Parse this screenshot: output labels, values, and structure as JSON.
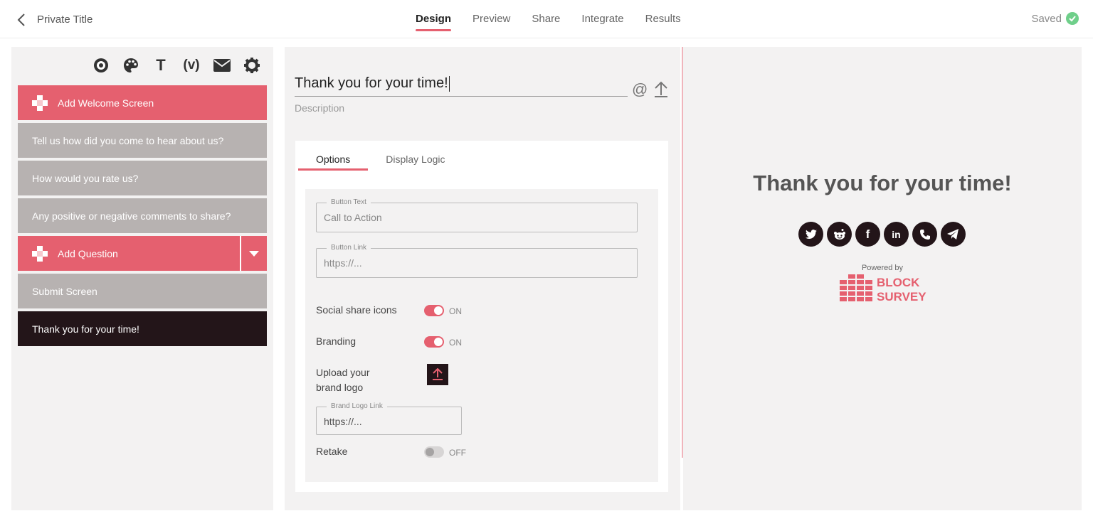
{
  "header": {
    "title": "Private Title",
    "tabs": [
      {
        "label": "Design",
        "active": true
      },
      {
        "label": "Preview",
        "active": false
      },
      {
        "label": "Share",
        "active": false
      },
      {
        "label": "Integrate",
        "active": false
      },
      {
        "label": "Results",
        "active": false
      }
    ],
    "status": "Saved"
  },
  "toolbar": {
    "icons": [
      "target-icon",
      "palette-icon",
      "text-icon",
      "variable-icon",
      "mail-icon",
      "gear-icon"
    ],
    "text_glyph": "T",
    "variable_glyph": "(v)"
  },
  "questions": {
    "add_welcome": "Add Welcome Screen",
    "items": [
      "Tell us how did you come to hear about us?",
      "How would you rate us?",
      "Any positive or negative comments to share?"
    ],
    "add_question": "Add Question",
    "submit": "Submit Screen",
    "thank_you": "Thank you for your time!"
  },
  "editor": {
    "title_value": "Thank you for your time!",
    "description_placeholder": "Description",
    "at_glyph": "@",
    "tabs": [
      {
        "label": "Options",
        "active": true
      },
      {
        "label": "Display Logic",
        "active": false
      }
    ],
    "button_text": {
      "label": "Button Text",
      "value": "Call to Action"
    },
    "button_link": {
      "label": "Button Link",
      "value": "https://..."
    },
    "social_share": {
      "label": "Social share icons",
      "state": "ON"
    },
    "branding": {
      "label": "Branding",
      "state": "ON"
    },
    "upload_logo_line1": "Upload your",
    "upload_logo_line2": "brand logo",
    "brand_logo_link": {
      "label": "Brand Logo Link",
      "value": "https://..."
    },
    "retake": {
      "label": "Retake",
      "state": "OFF"
    }
  },
  "preview": {
    "title": "Thank you for your time!",
    "social_icons": [
      "twitter-icon",
      "reddit-icon",
      "facebook-icon",
      "linkedin-icon",
      "phone-icon",
      "telegram-icon"
    ],
    "linkedin_glyph": "in",
    "facebook_glyph": "f",
    "powered_by": "Powered by",
    "brand_line1": "BLOCK",
    "brand_line2": "SURVEY"
  },
  "colors": {
    "accent": "#e5606f",
    "dark": "#231519",
    "item_gray": "#b7b2b1",
    "saved_green": "#6fcf8a"
  }
}
